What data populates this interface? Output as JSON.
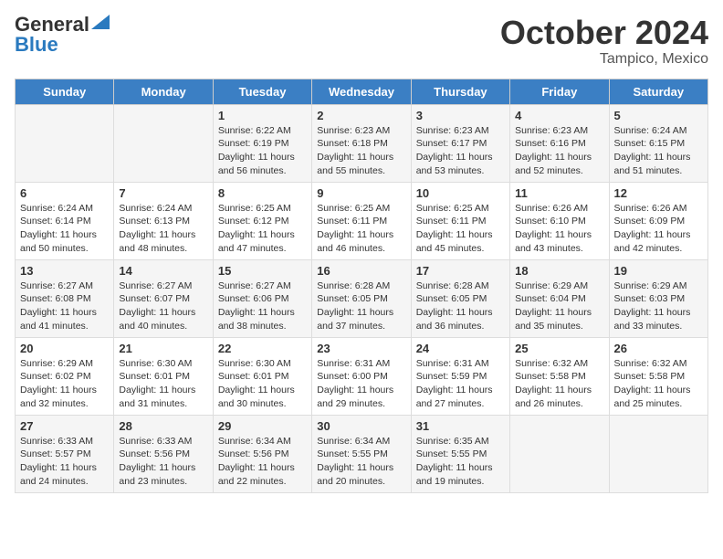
{
  "header": {
    "logo_general": "General",
    "logo_blue": "Blue",
    "month": "October 2024",
    "location": "Tampico, Mexico"
  },
  "days_of_week": [
    "Sunday",
    "Monday",
    "Tuesday",
    "Wednesday",
    "Thursday",
    "Friday",
    "Saturday"
  ],
  "weeks": [
    [
      {
        "day": "",
        "info": ""
      },
      {
        "day": "",
        "info": ""
      },
      {
        "day": "1",
        "info": "Sunrise: 6:22 AM\nSunset: 6:19 PM\nDaylight: 11 hours and 56 minutes."
      },
      {
        "day": "2",
        "info": "Sunrise: 6:23 AM\nSunset: 6:18 PM\nDaylight: 11 hours and 55 minutes."
      },
      {
        "day": "3",
        "info": "Sunrise: 6:23 AM\nSunset: 6:17 PM\nDaylight: 11 hours and 53 minutes."
      },
      {
        "day": "4",
        "info": "Sunrise: 6:23 AM\nSunset: 6:16 PM\nDaylight: 11 hours and 52 minutes."
      },
      {
        "day": "5",
        "info": "Sunrise: 6:24 AM\nSunset: 6:15 PM\nDaylight: 11 hours and 51 minutes."
      }
    ],
    [
      {
        "day": "6",
        "info": "Sunrise: 6:24 AM\nSunset: 6:14 PM\nDaylight: 11 hours and 50 minutes."
      },
      {
        "day": "7",
        "info": "Sunrise: 6:24 AM\nSunset: 6:13 PM\nDaylight: 11 hours and 48 minutes."
      },
      {
        "day": "8",
        "info": "Sunrise: 6:25 AM\nSunset: 6:12 PM\nDaylight: 11 hours and 47 minutes."
      },
      {
        "day": "9",
        "info": "Sunrise: 6:25 AM\nSunset: 6:11 PM\nDaylight: 11 hours and 46 minutes."
      },
      {
        "day": "10",
        "info": "Sunrise: 6:25 AM\nSunset: 6:11 PM\nDaylight: 11 hours and 45 minutes."
      },
      {
        "day": "11",
        "info": "Sunrise: 6:26 AM\nSunset: 6:10 PM\nDaylight: 11 hours and 43 minutes."
      },
      {
        "day": "12",
        "info": "Sunrise: 6:26 AM\nSunset: 6:09 PM\nDaylight: 11 hours and 42 minutes."
      }
    ],
    [
      {
        "day": "13",
        "info": "Sunrise: 6:27 AM\nSunset: 6:08 PM\nDaylight: 11 hours and 41 minutes."
      },
      {
        "day": "14",
        "info": "Sunrise: 6:27 AM\nSunset: 6:07 PM\nDaylight: 11 hours and 40 minutes."
      },
      {
        "day": "15",
        "info": "Sunrise: 6:27 AM\nSunset: 6:06 PM\nDaylight: 11 hours and 38 minutes."
      },
      {
        "day": "16",
        "info": "Sunrise: 6:28 AM\nSunset: 6:05 PM\nDaylight: 11 hours and 37 minutes."
      },
      {
        "day": "17",
        "info": "Sunrise: 6:28 AM\nSunset: 6:05 PM\nDaylight: 11 hours and 36 minutes."
      },
      {
        "day": "18",
        "info": "Sunrise: 6:29 AM\nSunset: 6:04 PM\nDaylight: 11 hours and 35 minutes."
      },
      {
        "day": "19",
        "info": "Sunrise: 6:29 AM\nSunset: 6:03 PM\nDaylight: 11 hours and 33 minutes."
      }
    ],
    [
      {
        "day": "20",
        "info": "Sunrise: 6:29 AM\nSunset: 6:02 PM\nDaylight: 11 hours and 32 minutes."
      },
      {
        "day": "21",
        "info": "Sunrise: 6:30 AM\nSunset: 6:01 PM\nDaylight: 11 hours and 31 minutes."
      },
      {
        "day": "22",
        "info": "Sunrise: 6:30 AM\nSunset: 6:01 PM\nDaylight: 11 hours and 30 minutes."
      },
      {
        "day": "23",
        "info": "Sunrise: 6:31 AM\nSunset: 6:00 PM\nDaylight: 11 hours and 29 minutes."
      },
      {
        "day": "24",
        "info": "Sunrise: 6:31 AM\nSunset: 5:59 PM\nDaylight: 11 hours and 27 minutes."
      },
      {
        "day": "25",
        "info": "Sunrise: 6:32 AM\nSunset: 5:58 PM\nDaylight: 11 hours and 26 minutes."
      },
      {
        "day": "26",
        "info": "Sunrise: 6:32 AM\nSunset: 5:58 PM\nDaylight: 11 hours and 25 minutes."
      }
    ],
    [
      {
        "day": "27",
        "info": "Sunrise: 6:33 AM\nSunset: 5:57 PM\nDaylight: 11 hours and 24 minutes."
      },
      {
        "day": "28",
        "info": "Sunrise: 6:33 AM\nSunset: 5:56 PM\nDaylight: 11 hours and 23 minutes."
      },
      {
        "day": "29",
        "info": "Sunrise: 6:34 AM\nSunset: 5:56 PM\nDaylight: 11 hours and 22 minutes."
      },
      {
        "day": "30",
        "info": "Sunrise: 6:34 AM\nSunset: 5:55 PM\nDaylight: 11 hours and 20 minutes."
      },
      {
        "day": "31",
        "info": "Sunrise: 6:35 AM\nSunset: 5:55 PM\nDaylight: 11 hours and 19 minutes."
      },
      {
        "day": "",
        "info": ""
      },
      {
        "day": "",
        "info": ""
      }
    ]
  ]
}
